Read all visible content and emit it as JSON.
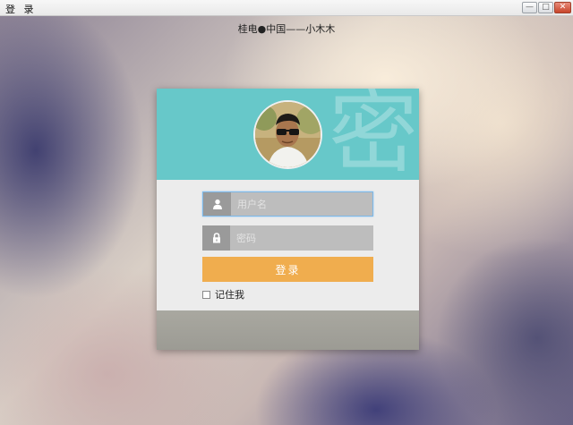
{
  "window": {
    "title": "登 录",
    "controls": {
      "minimize": "—",
      "maximize": "□",
      "close": "✕"
    }
  },
  "caption": "桂电●中国——小木木",
  "card": {
    "watermark": "密",
    "avatar_icon": "user-photo",
    "username": {
      "placeholder": "用户名",
      "value": "",
      "icon": "user-icon"
    },
    "password": {
      "placeholder": "密码",
      "value": "",
      "icon": "lock-icon"
    },
    "login_label": "登录",
    "remember_label": "记住我",
    "remember_checked": false
  },
  "colors": {
    "header_teal": "#67c8c9",
    "login_orange": "#f0ad4e",
    "field_gray": "#bdbdbd",
    "icon_gray": "#9a9a9a",
    "footer_gray": "#a3a29b"
  }
}
